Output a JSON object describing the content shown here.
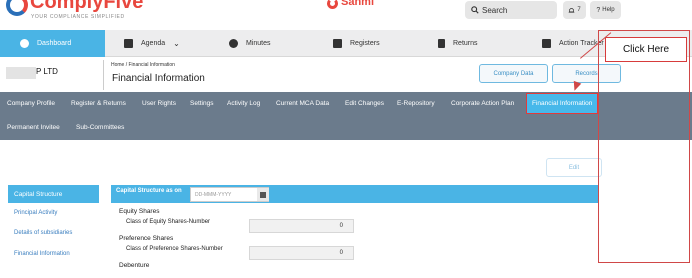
{
  "header": {
    "brand": "ComplyFive",
    "brand_tagline": "YOUR COMPLIANCE SIMPLIFIED",
    "center_logo": "Sanmi",
    "search_label": "Search",
    "notifications_count": "7",
    "help_label": "Help"
  },
  "topnav": {
    "items": [
      {
        "label": "Dashboard",
        "icon": "dashboard-icon"
      },
      {
        "label": "Agenda",
        "icon": "agenda-icon"
      },
      {
        "label": "Minutes",
        "icon": "clock-icon"
      },
      {
        "label": "Registers",
        "icon": "registers-icon"
      },
      {
        "label": "Returns",
        "icon": "returns-icon"
      },
      {
        "label": "Action Tracker",
        "icon": "tracker-icon"
      }
    ]
  },
  "titlebar": {
    "company": "P LTD",
    "breadcrumb": "Home  /  Financial Information",
    "title": "Financial Information",
    "company_data_btn": "Company Data",
    "records_btn": "Records"
  },
  "subnav": {
    "items": [
      "Company Profile",
      "Register & Returns",
      "User Rights",
      "Settings",
      "Activity Log",
      "Current MCA Data",
      "Edit Changes",
      "E-Repository",
      "Corporate Action Plan",
      "Financial Information",
      "Permanent Invitee",
      "Sub-Committees"
    ],
    "active": "Financial Information"
  },
  "callout": {
    "text": "Click Here"
  },
  "content": {
    "edit_btn": "Edit",
    "sidebar": [
      "Capital Structure",
      "Principal Activity",
      "Details of subsidiaries",
      "Financial Information"
    ],
    "section_title": "Capital Structure as on",
    "date_placeholder": "DD-MMM-YYYY",
    "equity_heading": "Equity Shares",
    "equity_label": "Class of Equity Shares-Number",
    "equity_value": "0",
    "pref_heading": "Preference Shares",
    "pref_label": "Class of Preference Shares-Number",
    "pref_value": "0",
    "debenture_heading": "Debenture"
  },
  "colors": {
    "accent": "#4ab4e5",
    "subnav_bg": "#6b7b8c",
    "brand_red": "#e8473e",
    "callout_red": "#d04848"
  }
}
